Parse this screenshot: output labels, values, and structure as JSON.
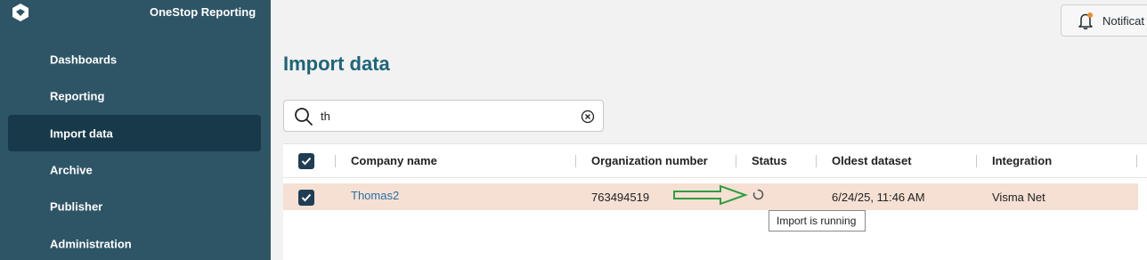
{
  "app": {
    "title": "OneStop Reporting"
  },
  "sidebar": {
    "items": [
      {
        "label": "Dashboards"
      },
      {
        "label": "Reporting"
      },
      {
        "label": "Import data"
      },
      {
        "label": "Archive"
      },
      {
        "label": "Publisher"
      },
      {
        "label": "Administration"
      }
    ],
    "active": "Import data"
  },
  "header": {
    "notifications_label": "Notificat"
  },
  "page": {
    "title": "Import data"
  },
  "search": {
    "value": "th"
  },
  "table": {
    "columns": [
      "Company name",
      "Organization number",
      "Status",
      "Oldest dataset",
      "Integration"
    ],
    "rows": [
      {
        "company": "Thomas2",
        "org_number": "763494519",
        "status": "Import is running",
        "oldest_dataset": "6/24/25, 11:46 AM",
        "integration": "Visma Net"
      }
    ]
  },
  "tooltip": {
    "text": "Import is running"
  },
  "colors": {
    "sidebar": "#2e5566",
    "sidebar_active": "#17394a",
    "title": "#1e6478",
    "row_highlight": "#f5e0d3",
    "arrow": "#2e9e3f"
  }
}
